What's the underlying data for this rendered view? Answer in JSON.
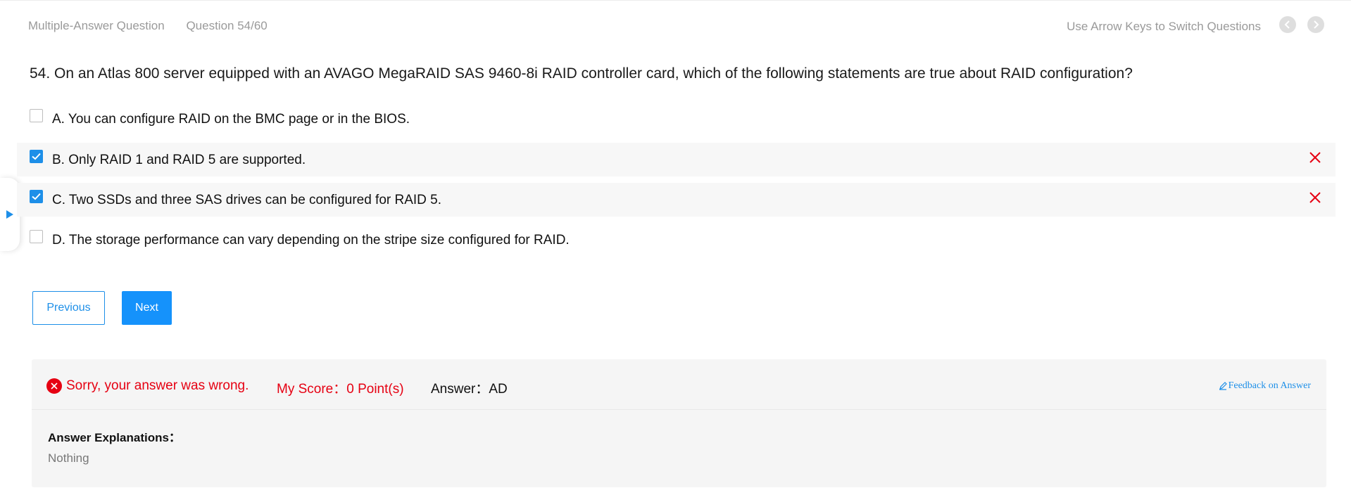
{
  "header": {
    "question_type": "Multiple-Answer Question",
    "question_progress": "Question 54/60",
    "hint": "Use Arrow Keys to Switch Questions"
  },
  "question": {
    "text": "54. On an Atlas 800 server equipped with an AVAGO MegaRAID SAS 9460-8i RAID controller card, which of the following statements are true about RAID configuration?",
    "options": [
      {
        "label": "A. You can configure RAID on the BMC page or in the BIOS.",
        "checked": false,
        "marked_wrong": false
      },
      {
        "label": "B. Only RAID 1 and RAID 5 are supported.",
        "checked": true,
        "marked_wrong": true
      },
      {
        "label": "C. Two SSDs and three SAS drives can be configured for RAID 5.",
        "checked": true,
        "marked_wrong": true
      },
      {
        "label": "D. The storage performance can vary depending on the stripe size configured for RAID.",
        "checked": false,
        "marked_wrong": false
      }
    ]
  },
  "buttons": {
    "previous": "Previous",
    "next": "Next"
  },
  "result": {
    "status": "Sorry, your answer was wrong.",
    "score": "My Score：0 Point(s)",
    "answer": "Answer：AD",
    "feedback": "Feedback on Answer",
    "explanation_title": "Answer Explanations：",
    "explanation_text": "Nothing"
  },
  "colors": {
    "accent": "#1d8fe8",
    "error": "#e60012",
    "panel_bg": "#f5f5f5"
  }
}
